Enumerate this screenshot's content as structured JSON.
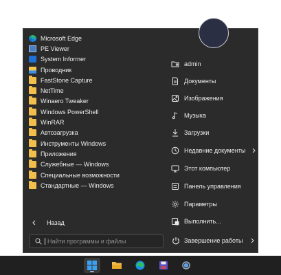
{
  "left_items": [
    {
      "label": "Microsoft Edge",
      "icon": "edge-icon"
    },
    {
      "label": "PE Viewer",
      "icon": "pe-viewer-icon"
    },
    {
      "label": "System Informer",
      "icon": "system-informer-icon"
    },
    {
      "label": "Проводник",
      "icon": "file-explorer-icon"
    },
    {
      "label": "FastStone Capture",
      "icon": "folder-icon"
    },
    {
      "label": "NetTime",
      "icon": "folder-icon"
    },
    {
      "label": "Winaero Tweaker",
      "icon": "folder-icon"
    },
    {
      "label": "Windows PowerShell",
      "icon": "folder-icon"
    },
    {
      "label": "WinRAR",
      "icon": "folder-icon"
    },
    {
      "label": "Автозагрузка",
      "icon": "folder-icon"
    },
    {
      "label": "Инструменты Windows",
      "icon": "folder-icon"
    },
    {
      "label": "Приложения",
      "icon": "folder-icon"
    },
    {
      "label": "Служебные — Windows",
      "icon": "folder-icon"
    },
    {
      "label": "Специальные возможности",
      "icon": "folder-icon"
    },
    {
      "label": "Стандартные — Windows",
      "icon": "folder-icon"
    }
  ],
  "right_items": [
    {
      "label": "admin",
      "icon": "user-folder-icon"
    },
    {
      "label": "Документы",
      "icon": "document-icon"
    },
    {
      "label": "Изображения",
      "icon": "image-icon"
    },
    {
      "label": "Музыка",
      "icon": "music-note-icon"
    },
    {
      "label": "Загрузки",
      "icon": "download-icon"
    },
    {
      "label": "Недавние документы",
      "icon": "clock-icon",
      "submenu": true
    },
    {
      "label": "Этот компьютер",
      "icon": "computer-icon"
    },
    {
      "label": "Панель управления",
      "icon": "control-panel-icon"
    },
    {
      "label": "Параметры",
      "icon": "gear-icon"
    },
    {
      "label": "Выполнить...",
      "icon": "run-icon"
    }
  ],
  "back_label": "Назад",
  "search": {
    "placeholder": "Найти программы и файлы",
    "value": ""
  },
  "shutdown_label": "Завершение работы",
  "taskbar": [
    {
      "name": "start",
      "icon": "windows-logo-icon",
      "active": true
    },
    {
      "name": "file-explorer",
      "icon": "folder-icon"
    },
    {
      "name": "edge",
      "icon": "edge-icon"
    },
    {
      "name": "save",
      "icon": "floppy-disk-icon"
    },
    {
      "name": "settings",
      "icon": "gear-icon"
    }
  ],
  "colors": {
    "menu_bg": "#2b2b2b",
    "folder": "#f2be4c",
    "taskbar_bg": "#202020",
    "accent": "#0078d4"
  }
}
